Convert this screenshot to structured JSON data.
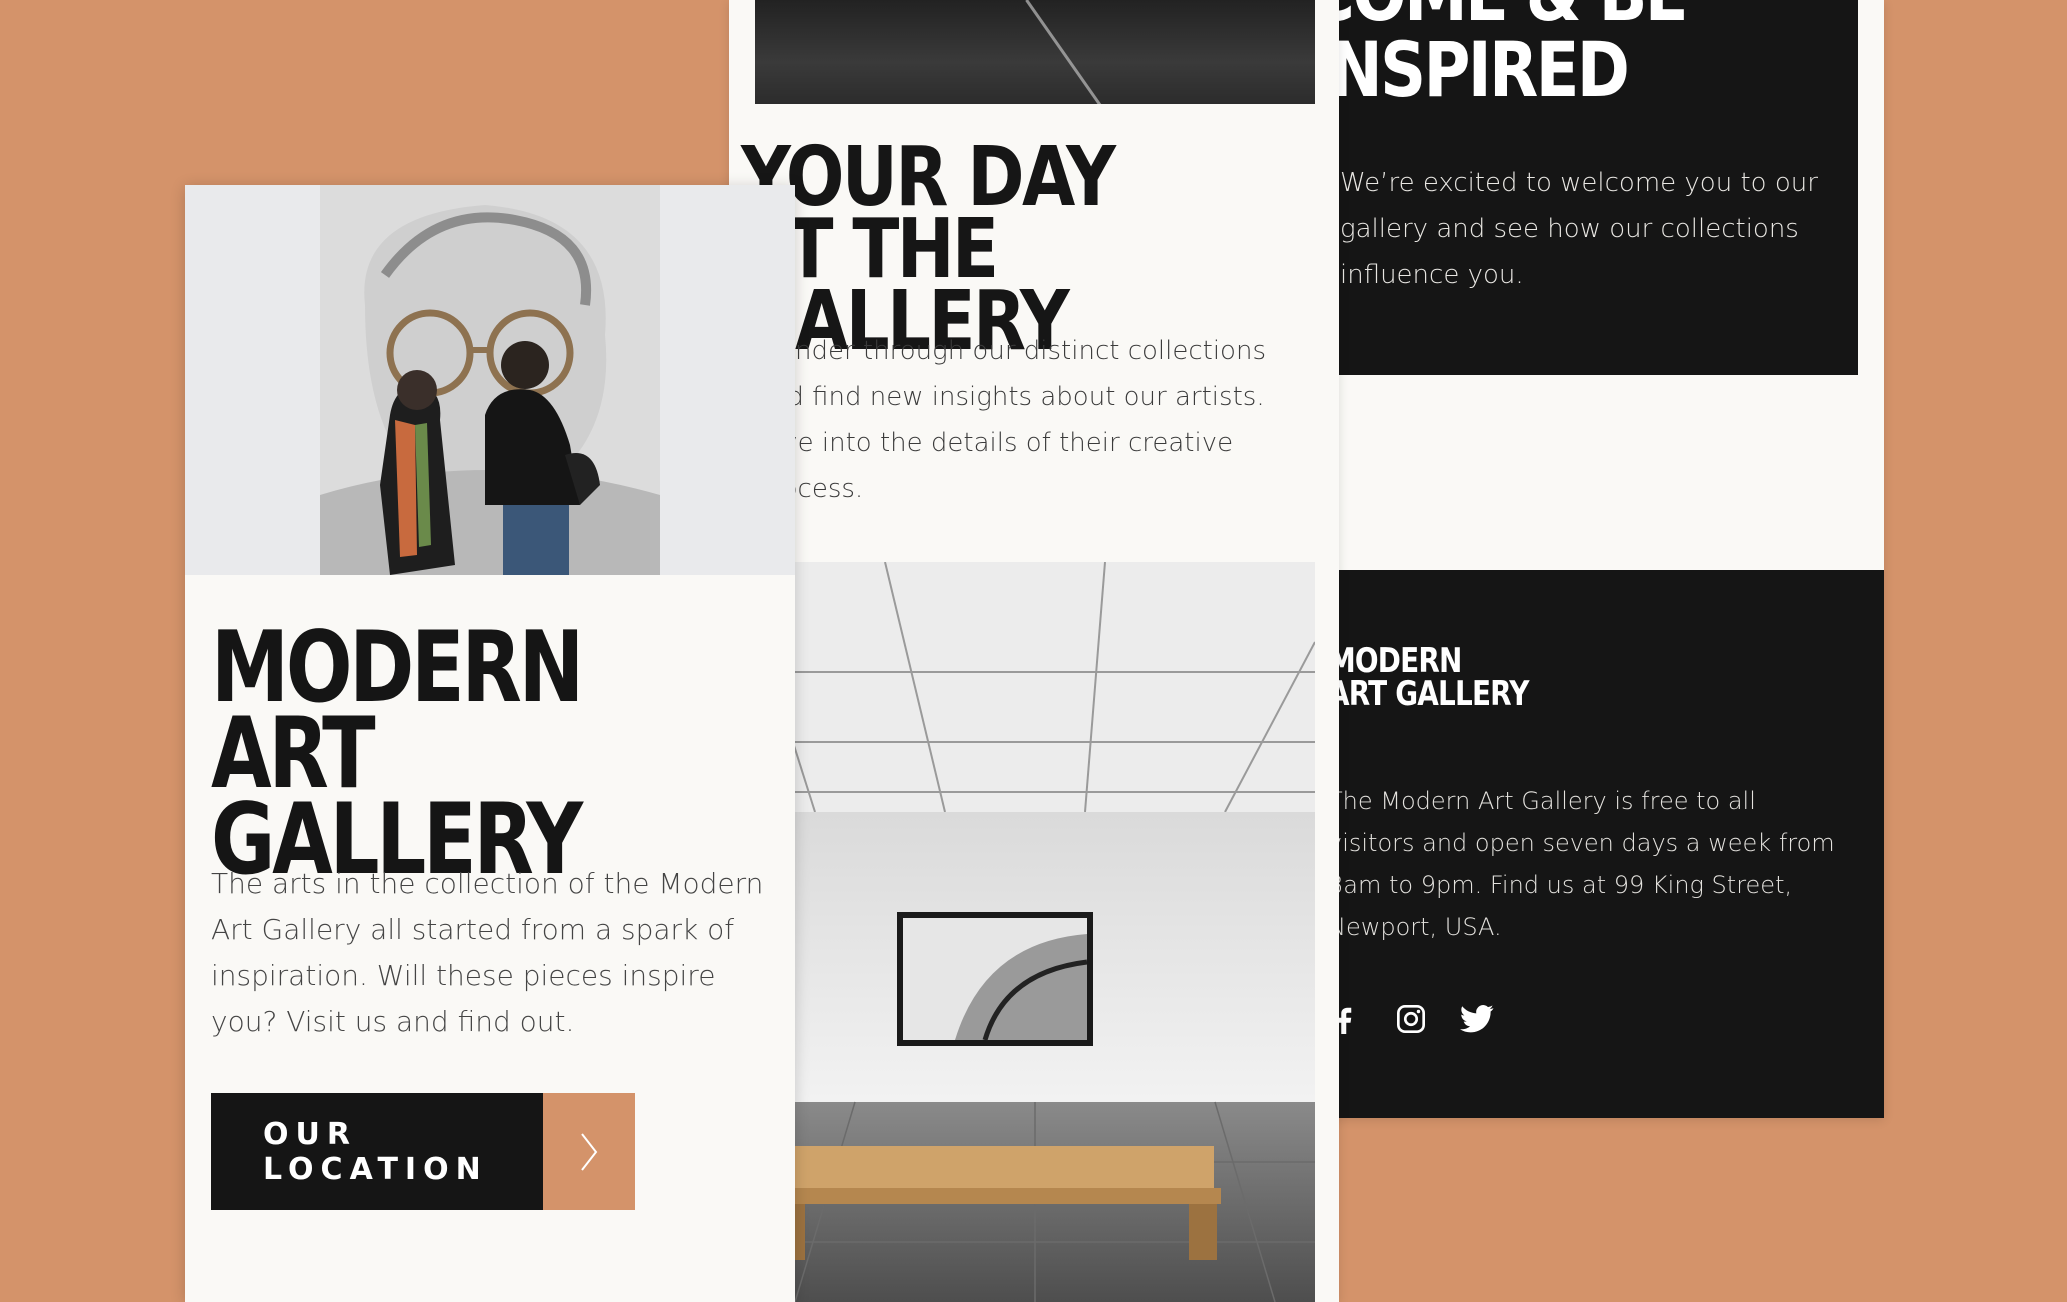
{
  "colors": {
    "background": "#d4936a",
    "dark": "#151515",
    "paper": "#faf9f6",
    "accent": "#d4936a"
  },
  "right_card": {
    "welcome_heading": "COME & BE\nINSPIRED",
    "welcome_body": "We’re excited to welcome you to our gallery and see how our collections influence you.",
    "footer_logo": "MODERN\nART GALLERY",
    "footer_text": "The Modern Art Gallery is free to all visitors and open seven days a week from 8am to 9pm. Find us at 99 King Street, Newport, USA.",
    "social_icons": [
      "facebook-icon",
      "instagram-icon",
      "twitter-icon"
    ]
  },
  "middle_card": {
    "day_heading": "YOUR DAY\nAT THE GALLERY",
    "day_body": "Wander through our distinct collections and find new insights about our artists. Dive into the details of their creative process."
  },
  "left_card": {
    "title": "MODERN\nART GALLERY",
    "lead": "The arts in the collection of the Modern Art Gallery all started from a spark of inspiration. Will these pieces inspire you? Visit us and find out.",
    "cta_label": "OUR LOCATION",
    "cta_icon": "chevron-right-icon"
  }
}
